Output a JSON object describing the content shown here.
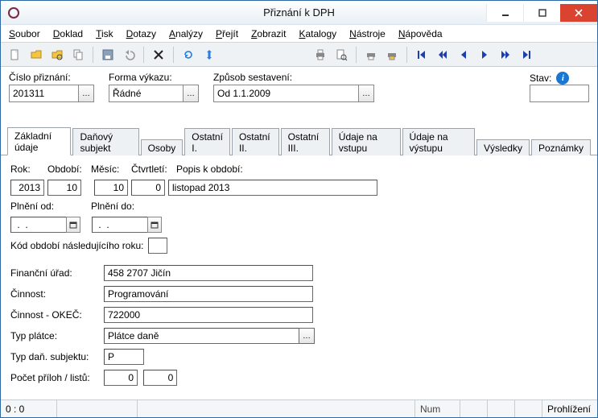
{
  "window": {
    "title": "Přiznání k DPH"
  },
  "menu": {
    "items": [
      {
        "label": "Soubor",
        "ul": "S",
        "rest": "oubor"
      },
      {
        "label": "Doklad",
        "ul": "D",
        "rest": "oklad"
      },
      {
        "label": "Tisk",
        "ul": "T",
        "rest": "isk"
      },
      {
        "label": "Dotazy",
        "ul": "D",
        "rest": "otazy"
      },
      {
        "label": "Analýzy",
        "ul": "A",
        "rest": "nalýzy"
      },
      {
        "label": "Přejít",
        "ul": "P",
        "rest": "řejít"
      },
      {
        "label": "Zobrazit",
        "ul": "Z",
        "rest": "obrazit"
      },
      {
        "label": "Katalogy",
        "ul": "K",
        "rest": "atalogy"
      },
      {
        "label": "Nástroje",
        "ul": "N",
        "rest": "ástroje"
      },
      {
        "label": "Nápověda",
        "ul": "N",
        "rest": "ápověda"
      }
    ]
  },
  "header": {
    "cislo_label": "Číslo přiznání:",
    "cislo_value": "201311",
    "forma_label": "Forma výkazu:",
    "forma_value": "Řádné",
    "zpusob_label": "Způsob sestavení:",
    "zpusob_value": "Od 1.1.2009",
    "stav_label": "Stav:",
    "stav_value": ""
  },
  "tabs": {
    "items": [
      "Základní údaje",
      "Daňový subjekt",
      "Osoby",
      "Ostatní I.",
      "Ostatní II.",
      "Ostatní III.",
      "Údaje na vstupu",
      "Údaje na výstupu",
      "Výsledky",
      "Poznámky"
    ],
    "active_index": 0
  },
  "form": {
    "rok_label": "Rok:",
    "rok_value": "2013",
    "obdobi_label": "Období:",
    "obdobi_value": "10",
    "mesic_label": "Měsíc:",
    "mesic_value": "10",
    "ctvrtleti_label": "Čtvrtletí:",
    "ctvrtleti_value": "0",
    "popis_label": "Popis k období:",
    "popis_value": "listopad 2013",
    "plneni_od_label": "Plnění od:",
    "plneni_od_value": " .  .",
    "plneni_do_label": "Plnění do:",
    "plneni_do_value": " .  .",
    "kod_label": "Kód období následujícího roku:",
    "kod_value": "",
    "financni_urad_label": "Finanční úřad:",
    "financni_urad_value": "458 2707 Jičín",
    "cinnost_label": "Činnost:",
    "cinnost_value": "Programování",
    "cinnost_okec_label": "Činnost - OKEČ:",
    "cinnost_okec_value": "722000",
    "typ_platce_label": "Typ plátce:",
    "typ_platce_value": "Plátce daně",
    "typ_dan_subj_label": "Typ daň. subjektu:",
    "typ_dan_subj_value": "P",
    "pocet_priloh_label": "Počet příloh / listů:",
    "pocet_priloh_a": "0",
    "pocet_priloh_b": "0"
  },
  "statusbar": {
    "pos": "0 :   0",
    "num": "Num",
    "mode": "Prohlížení"
  },
  "glyphs": {
    "ellipsis": "…",
    "first": "|◀",
    "prev_page": "◀◀",
    "prev": "◀",
    "next": "▶",
    "next_page": "▶▶",
    "last": "▶|"
  }
}
